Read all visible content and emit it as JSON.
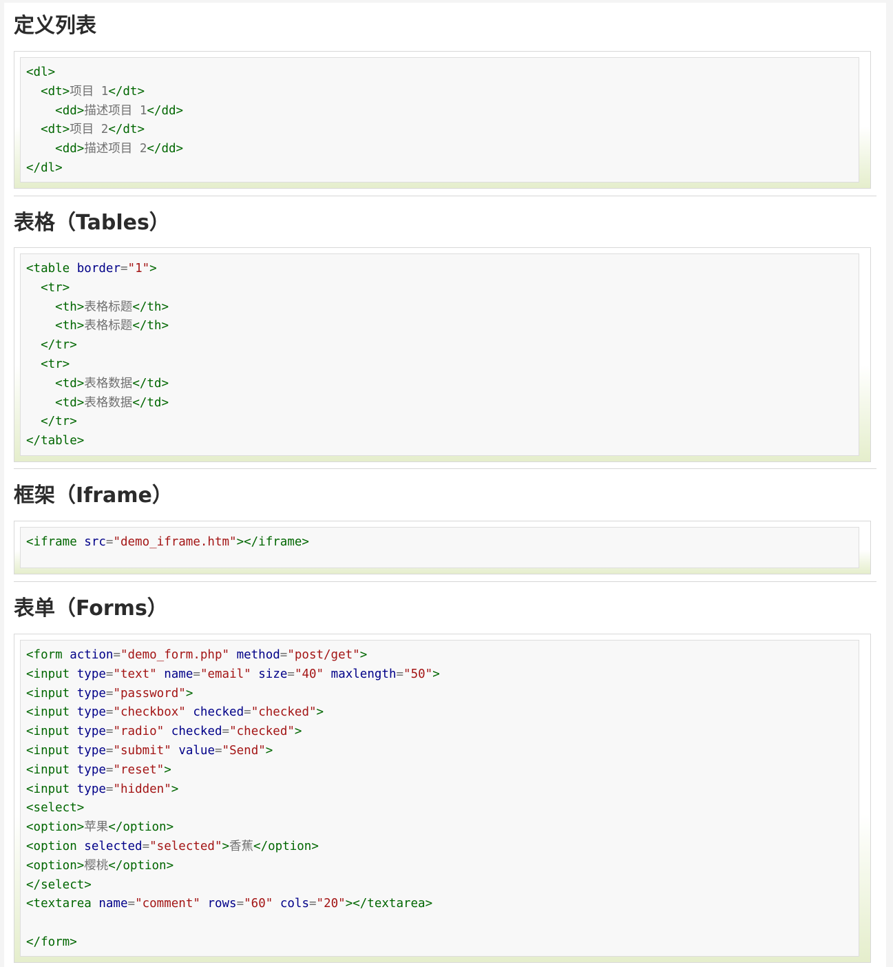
{
  "sections": [
    {
      "title": "定义列表",
      "lines": [
        [
          [
            "t",
            "<dl>"
          ]
        ],
        [
          [
            "p",
            "  "
          ],
          [
            "t",
            "<dt>"
          ],
          [
            "p",
            "项目 1"
          ],
          [
            "t",
            "</dt>"
          ]
        ],
        [
          [
            "p",
            "    "
          ],
          [
            "t",
            "<dd>"
          ],
          [
            "p",
            "描述项目 1"
          ],
          [
            "t",
            "</dd>"
          ]
        ],
        [
          [
            "p",
            "  "
          ],
          [
            "t",
            "<dt>"
          ],
          [
            "p",
            "项目 2"
          ],
          [
            "t",
            "</dt>"
          ]
        ],
        [
          [
            "p",
            "    "
          ],
          [
            "t",
            "<dd>"
          ],
          [
            "p",
            "描述项目 2"
          ],
          [
            "t",
            "</dd>"
          ]
        ],
        [
          [
            "t",
            "</dl>"
          ]
        ]
      ]
    },
    {
      "title": "表格（Tables）",
      "lines": [
        [
          [
            "t",
            "<table "
          ],
          [
            "a",
            "border"
          ],
          [
            "p",
            "="
          ],
          [
            "v",
            "\"1\""
          ],
          [
            "t",
            ">"
          ]
        ],
        [
          [
            "p",
            "  "
          ],
          [
            "t",
            "<tr>"
          ]
        ],
        [
          [
            "p",
            "    "
          ],
          [
            "t",
            "<th>"
          ],
          [
            "p",
            "表格标题"
          ],
          [
            "t",
            "</th>"
          ]
        ],
        [
          [
            "p",
            "    "
          ],
          [
            "t",
            "<th>"
          ],
          [
            "p",
            "表格标题"
          ],
          [
            "t",
            "</th>"
          ]
        ],
        [
          [
            "p",
            "  "
          ],
          [
            "t",
            "</tr>"
          ]
        ],
        [
          [
            "p",
            "  "
          ],
          [
            "t",
            "<tr>"
          ]
        ],
        [
          [
            "p",
            "    "
          ],
          [
            "t",
            "<td>"
          ],
          [
            "p",
            "表格数据"
          ],
          [
            "t",
            "</td>"
          ]
        ],
        [
          [
            "p",
            "    "
          ],
          [
            "t",
            "<td>"
          ],
          [
            "p",
            "表格数据"
          ],
          [
            "t",
            "</td>"
          ]
        ],
        [
          [
            "p",
            "  "
          ],
          [
            "t",
            "</tr>"
          ]
        ],
        [
          [
            "t",
            "</table>"
          ]
        ]
      ]
    },
    {
      "title": "框架（Iframe）",
      "lines": [
        [
          [
            "t",
            "<iframe "
          ],
          [
            "a",
            "src"
          ],
          [
            "p",
            "="
          ],
          [
            "v",
            "\"demo_iframe.htm\""
          ],
          [
            "t",
            "></iframe>"
          ]
        ]
      ]
    },
    {
      "title": "表单（Forms）",
      "lines": [
        [
          [
            "t",
            "<form "
          ],
          [
            "a",
            "action"
          ],
          [
            "p",
            "="
          ],
          [
            "v",
            "\"demo_form.php\""
          ],
          [
            "p",
            " "
          ],
          [
            "a",
            "method"
          ],
          [
            "p",
            "="
          ],
          [
            "v",
            "\"post/get\""
          ],
          [
            "t",
            ">"
          ]
        ],
        [
          [
            "t",
            "<input "
          ],
          [
            "a",
            "type"
          ],
          [
            "p",
            "="
          ],
          [
            "v",
            "\"text\""
          ],
          [
            "p",
            " "
          ],
          [
            "a",
            "name"
          ],
          [
            "p",
            "="
          ],
          [
            "v",
            "\"email\""
          ],
          [
            "p",
            " "
          ],
          [
            "a",
            "size"
          ],
          [
            "p",
            "="
          ],
          [
            "v",
            "\"40\""
          ],
          [
            "p",
            " "
          ],
          [
            "a",
            "maxlength"
          ],
          [
            "p",
            "="
          ],
          [
            "v",
            "\"50\""
          ],
          [
            "t",
            ">"
          ]
        ],
        [
          [
            "t",
            "<input "
          ],
          [
            "a",
            "type"
          ],
          [
            "p",
            "="
          ],
          [
            "v",
            "\"password\""
          ],
          [
            "t",
            ">"
          ]
        ],
        [
          [
            "t",
            "<input "
          ],
          [
            "a",
            "type"
          ],
          [
            "p",
            "="
          ],
          [
            "v",
            "\"checkbox\""
          ],
          [
            "p",
            " "
          ],
          [
            "a",
            "checked"
          ],
          [
            "p",
            "="
          ],
          [
            "v",
            "\"checked\""
          ],
          [
            "t",
            ">"
          ]
        ],
        [
          [
            "t",
            "<input "
          ],
          [
            "a",
            "type"
          ],
          [
            "p",
            "="
          ],
          [
            "v",
            "\"radio\""
          ],
          [
            "p",
            " "
          ],
          [
            "a",
            "checked"
          ],
          [
            "p",
            "="
          ],
          [
            "v",
            "\"checked\""
          ],
          [
            "t",
            ">"
          ]
        ],
        [
          [
            "t",
            "<input "
          ],
          [
            "a",
            "type"
          ],
          [
            "p",
            "="
          ],
          [
            "v",
            "\"submit\""
          ],
          [
            "p",
            " "
          ],
          [
            "a",
            "value"
          ],
          [
            "p",
            "="
          ],
          [
            "v",
            "\"Send\""
          ],
          [
            "t",
            ">"
          ]
        ],
        [
          [
            "t",
            "<input "
          ],
          [
            "a",
            "type"
          ],
          [
            "p",
            "="
          ],
          [
            "v",
            "\"reset\""
          ],
          [
            "t",
            ">"
          ]
        ],
        [
          [
            "t",
            "<input "
          ],
          [
            "a",
            "type"
          ],
          [
            "p",
            "="
          ],
          [
            "v",
            "\"hidden\""
          ],
          [
            "t",
            ">"
          ]
        ],
        [
          [
            "t",
            "<select>"
          ]
        ],
        [
          [
            "t",
            "<option>"
          ],
          [
            "p",
            "苹果"
          ],
          [
            "t",
            "</option>"
          ]
        ],
        [
          [
            "t",
            "<option "
          ],
          [
            "a",
            "selected"
          ],
          [
            "p",
            "="
          ],
          [
            "v",
            "\"selected\""
          ],
          [
            "t",
            ">"
          ],
          [
            "p",
            "香蕉"
          ],
          [
            "t",
            "</option>"
          ]
        ],
        [
          [
            "t",
            "<option>"
          ],
          [
            "p",
            "樱桃"
          ],
          [
            "t",
            "</option>"
          ]
        ],
        [
          [
            "t",
            "</select>"
          ]
        ],
        [
          [
            "t",
            "<textarea "
          ],
          [
            "a",
            "name"
          ],
          [
            "p",
            "="
          ],
          [
            "v",
            "\"comment\""
          ],
          [
            "p",
            " "
          ],
          [
            "a",
            "rows"
          ],
          [
            "p",
            "="
          ],
          [
            "v",
            "\"60\""
          ],
          [
            "p",
            " "
          ],
          [
            "a",
            "cols"
          ],
          [
            "p",
            "="
          ],
          [
            "v",
            "\"20\""
          ],
          [
            "t",
            "></textarea>"
          ]
        ],
        [],
        [
          [
            "t",
            "</form>"
          ]
        ]
      ]
    }
  ]
}
